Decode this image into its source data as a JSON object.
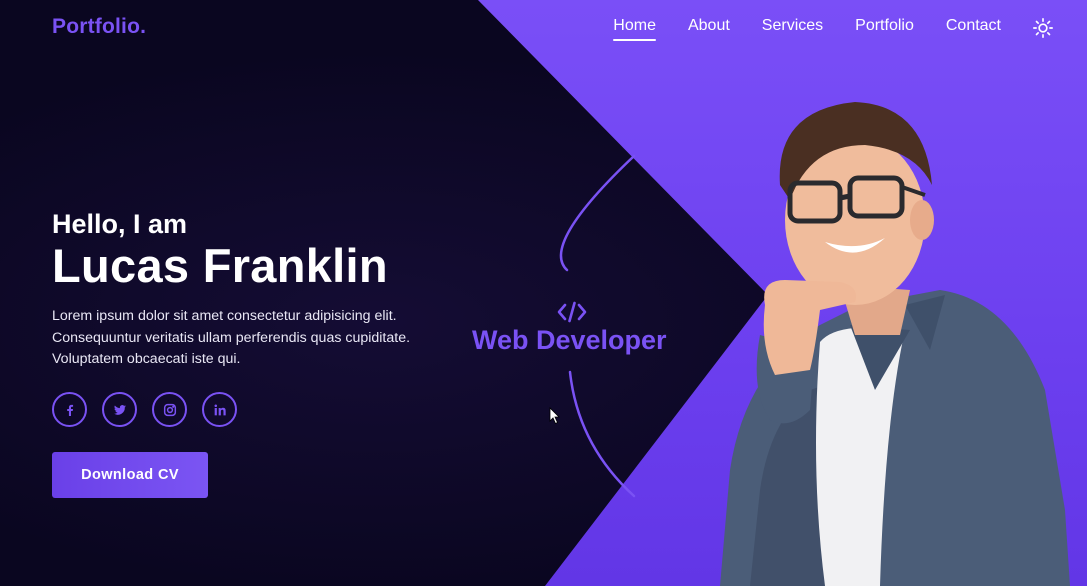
{
  "header": {
    "logo": "Portfolio.",
    "nav": [
      "Home",
      "About",
      "Services",
      "Portfolio",
      "Contact"
    ],
    "active_nav": "Home",
    "theme_icon": "sun-icon"
  },
  "hero": {
    "greeting": "Hello, I am",
    "name": "Lucas Franklin",
    "description": "Lorem ipsum dolor sit amet consectetur adipisicing elit. Consequuntur veritatis ullam perferendis quas cupiditate. Voluptatem obcaecati iste qui.",
    "socials": [
      "facebook-icon",
      "twitter-icon",
      "instagram-icon",
      "linkedin-icon"
    ],
    "cta_label": "Download CV",
    "role_icon": "code-icon",
    "role": "Web Developer"
  },
  "colors": {
    "background": "#0a0620",
    "accent": "#7a52f4",
    "panel": "#7046f2",
    "text": "#ffffff"
  }
}
